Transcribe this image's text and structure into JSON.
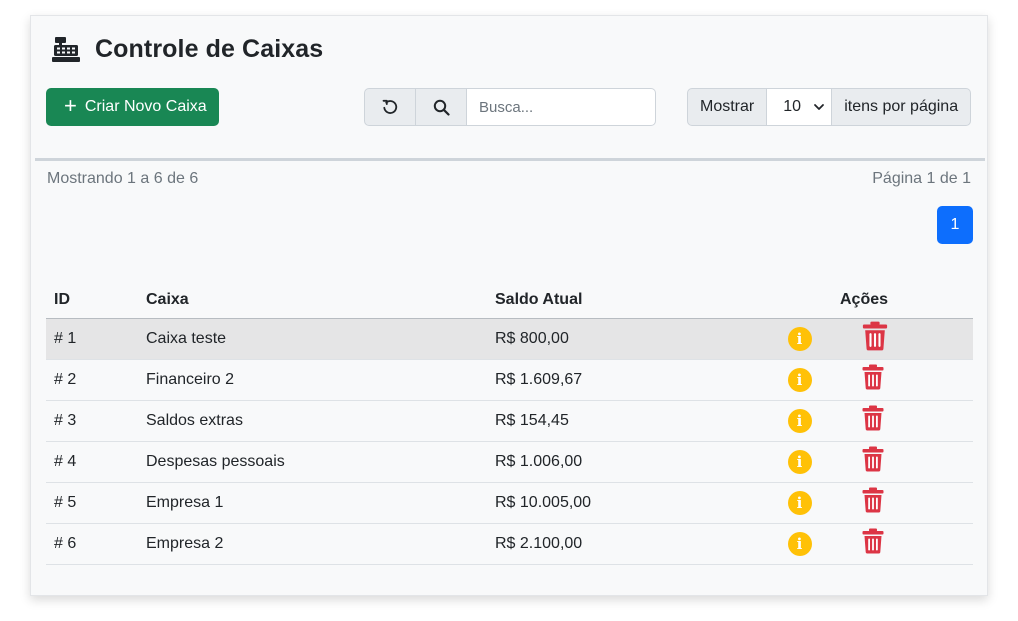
{
  "header": {
    "title": "Controle de Caixas",
    "icon": "cash-register-icon"
  },
  "toolbar": {
    "create_label": "Criar Novo Caixa",
    "search_placeholder": "Busca...",
    "show_label": "Mostrar",
    "page_size": "10",
    "per_page_label": "itens por página"
  },
  "pagination": {
    "showing": "Mostrando 1 a 6 de 6",
    "page_of": "Página 1 de 1",
    "current_page": "1"
  },
  "table": {
    "headers": {
      "id": "ID",
      "name": "Caixa",
      "saldo": "Saldo Atual",
      "actions": "Ações"
    },
    "rows": [
      {
        "id": "# 1",
        "name": "Caixa teste",
        "saldo": "R$ 800,00"
      },
      {
        "id": "# 2",
        "name": "Financeiro 2",
        "saldo": "R$ 1.609,67"
      },
      {
        "id": "# 3",
        "name": "Saldos extras",
        "saldo": "R$ 154,45"
      },
      {
        "id": "# 4",
        "name": "Despesas pessoais",
        "saldo": "R$ 1.006,00"
      },
      {
        "id": "# 5",
        "name": "Empresa 1",
        "saldo": "R$ 10.005,00"
      },
      {
        "id": "# 6",
        "name": "Empresa 2",
        "saldo": "R$ 2.100,00"
      }
    ]
  },
  "colors": {
    "success": "#198754",
    "primary": "#0d6efd",
    "warning": "#ffc107",
    "danger": "#dc3545"
  }
}
